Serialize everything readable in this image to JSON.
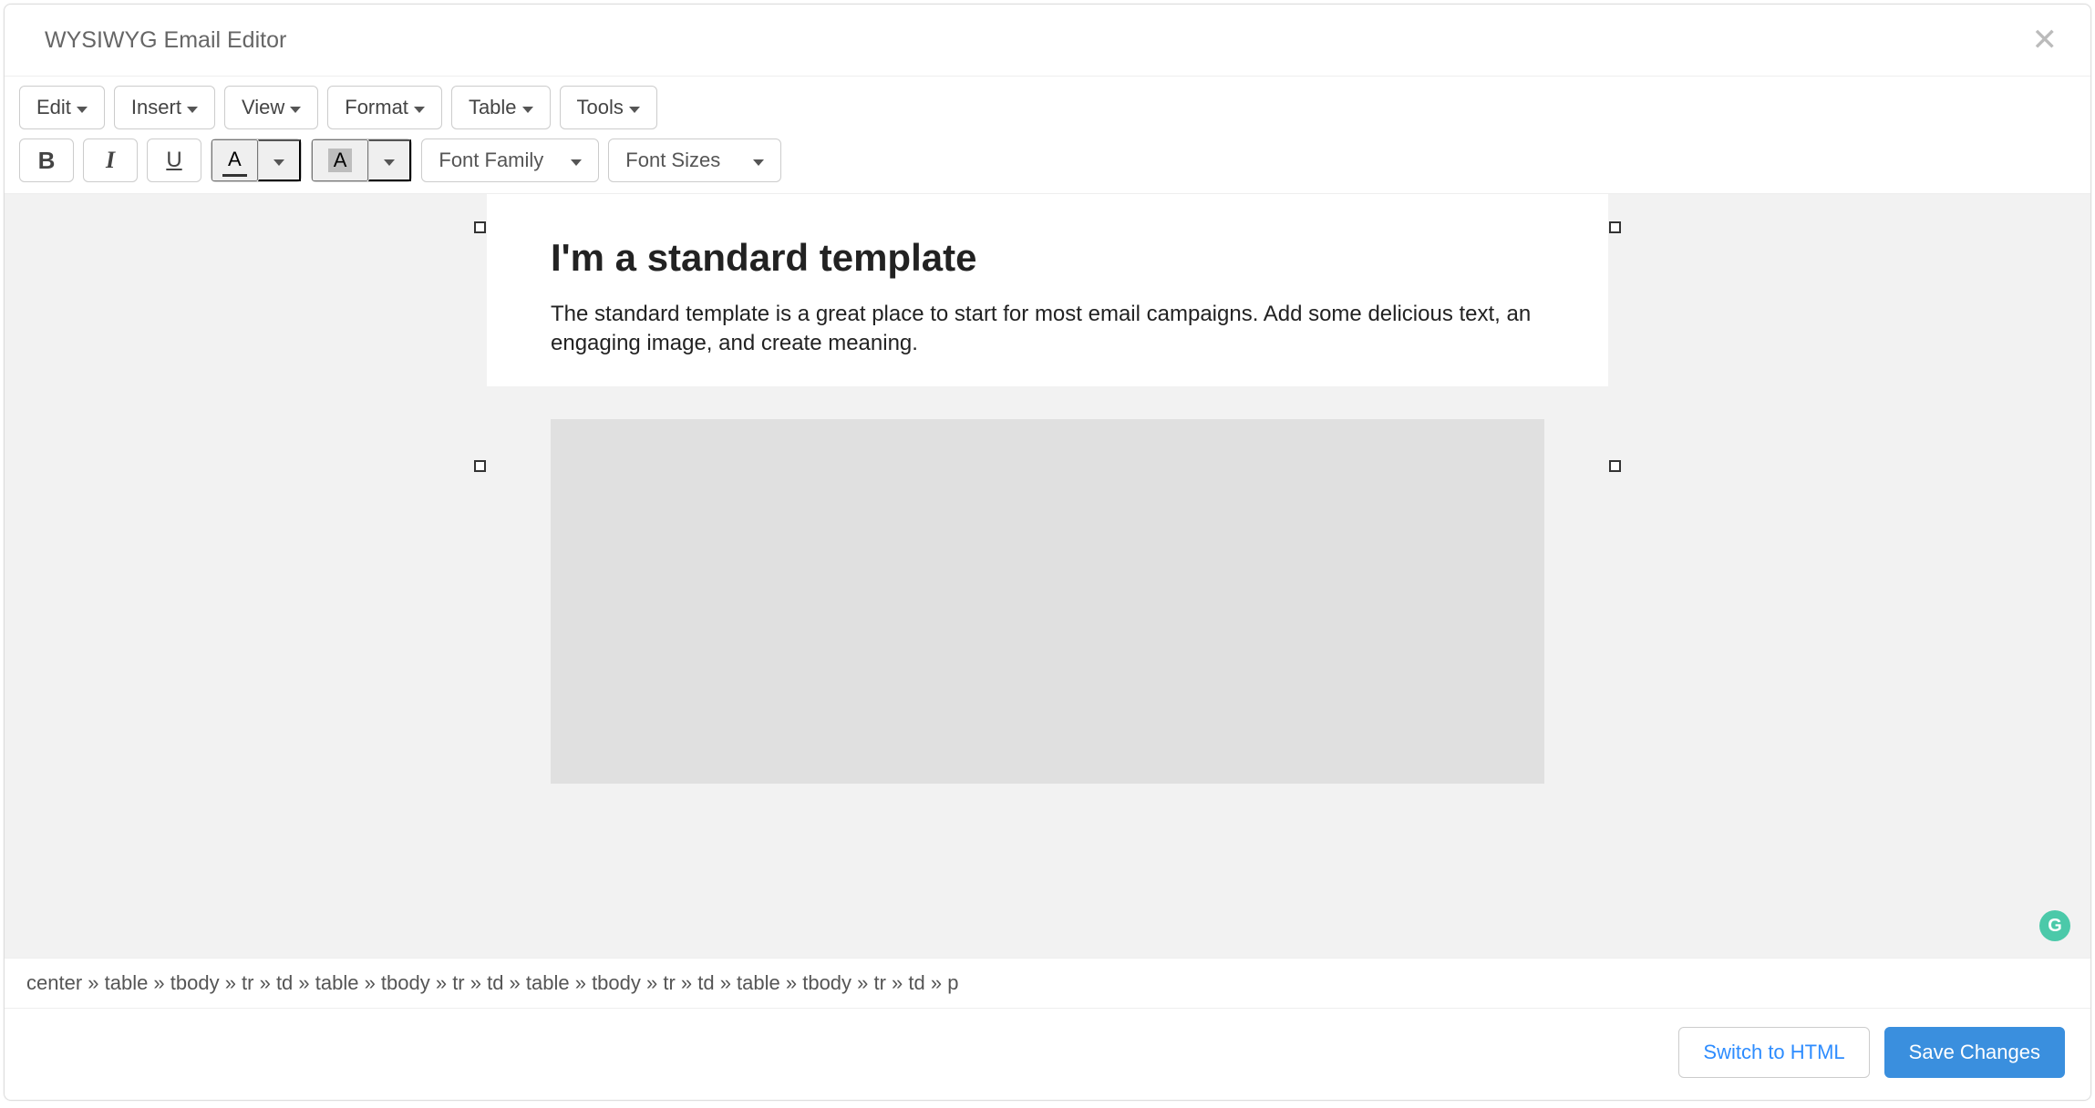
{
  "modal": {
    "title": "WYSIWYG Email Editor"
  },
  "menus": {
    "edit": "Edit",
    "insert": "Insert",
    "view": "View",
    "format": "Format",
    "table": "Table",
    "tools": "Tools"
  },
  "toolbar": {
    "bold_glyph": "B",
    "italic_glyph": "I",
    "underline_glyph": "U",
    "textcolor_glyph": "A",
    "bgcolor_glyph": "A",
    "font_family_label": "Font Family",
    "font_sizes_label": "Font Sizes"
  },
  "content": {
    "heading": "I'm a standard template",
    "paragraph": "The standard template is a great place to start for most email campaigns. Add some delicious text, an engaging image, and create meaning."
  },
  "path_bar": "center » table » tbody » tr » td » table » tbody » tr » td » table » tbody » tr » td » table » tbody » tr » td » p",
  "footer": {
    "switch_label": "Switch to HTML",
    "save_label": "Save Changes"
  },
  "grammarly_glyph": "G"
}
